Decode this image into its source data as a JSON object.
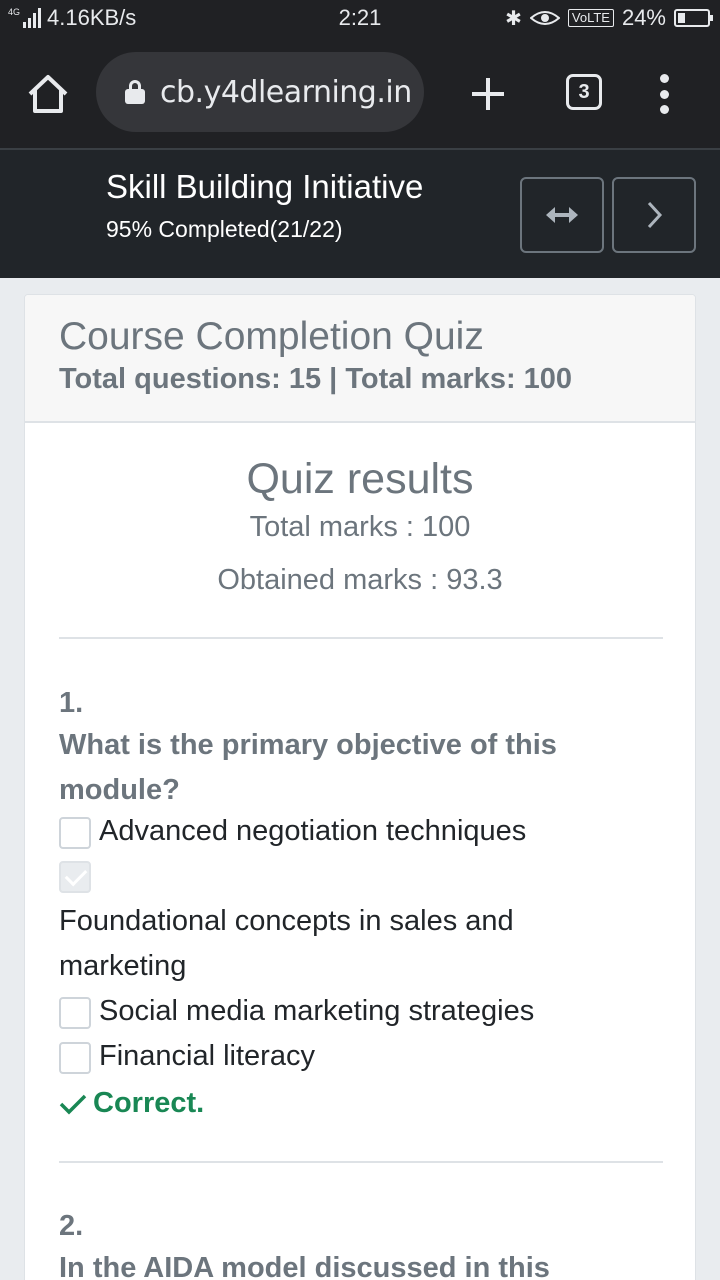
{
  "status_bar": {
    "network": "4G",
    "speed": "4.16KB/s",
    "time": "2:21",
    "volte": "VoLTE",
    "battery": "24%",
    "battery_level": 0.24
  },
  "browser": {
    "url": "cb.y4dlearning.in",
    "tab_count": "3"
  },
  "course": {
    "title": "Skill Building Initiative",
    "progress": "95% Completed(21/22)"
  },
  "quiz": {
    "title": "Course Completion Quiz",
    "meta": "Total questions: 15 | Total marks: 100",
    "results_title": "Quiz results",
    "total_marks": "Total marks : 100",
    "obtained_marks": "Obtained marks : 93.3"
  },
  "questions": [
    {
      "number": "1.",
      "text": "What is the primary objective of this module?",
      "options": [
        {
          "label": "Advanced negotiation techniques",
          "checked": false
        },
        {
          "label": "Foundational concepts in sales and marketing",
          "checked": true
        },
        {
          "label": "Social media marketing strategies",
          "checked": false
        },
        {
          "label": "Financial literacy",
          "checked": false
        }
      ],
      "result": "Correct."
    },
    {
      "number": "2.",
      "text": "In the AIDA model discussed in this"
    }
  ],
  "colors": {
    "header_bg": "#212529",
    "muted_text": "#6c757d",
    "success": "#198754"
  }
}
